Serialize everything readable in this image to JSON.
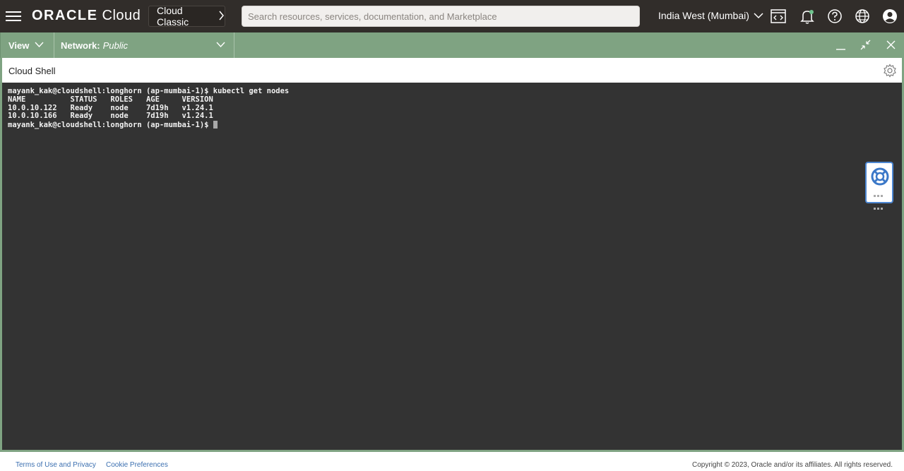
{
  "topbar": {
    "brand_oracle": "ORACLE",
    "brand_cloud": "Cloud",
    "classic_label": "Cloud Classic",
    "search_placeholder": "Search resources, services, documentation, and Marketplace",
    "region": "India West (Mumbai)",
    "icons": [
      "menu-icon",
      "code-editor-icon",
      "bell-icon",
      "help-icon",
      "globe-icon",
      "user-icon"
    ]
  },
  "toolbar": {
    "view_label": "View",
    "network_label": "Network:",
    "network_value": "Public"
  },
  "shell": {
    "title": "Cloud Shell",
    "lines": [
      "mayank_kak@cloudshell:longhorn (ap-mumbai-1)$ kubectl get nodes",
      "NAME          STATUS   ROLES   AGE     VERSION",
      "10.0.10.122   Ready    node    7d19h   v1.24.1",
      "10.0.10.166   Ready    node    7d19h   v1.24.1"
    ],
    "prompt": "mayank_kak@cloudshell:longhorn (ap-mumbai-1)$ "
  },
  "footer": {
    "terms": "Terms of Use and Privacy",
    "cookies": "Cookie Preferences",
    "copyright": "Copyright © 2023, Oracle and/or its affiliates. All rights reserved."
  },
  "colors": {
    "topbar_bg": "#312d2a",
    "green_accent": "#7fa382",
    "terminal_bg": "#333333",
    "link": "#3b6fb0",
    "help_border": "#4c86d1"
  }
}
